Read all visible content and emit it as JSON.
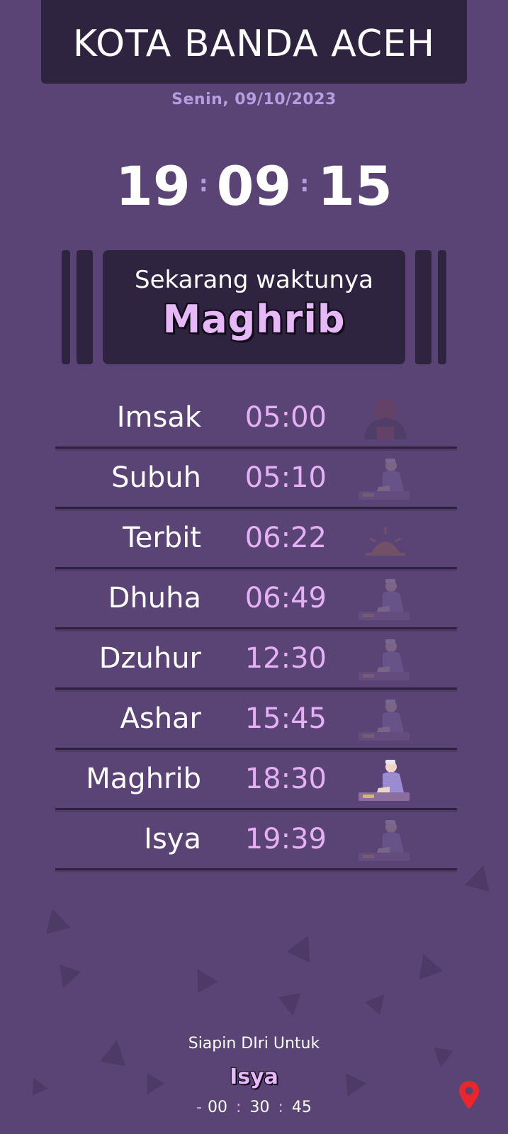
{
  "header": {
    "city": "KOTA BANDA ACEH",
    "date": "Senin, 09/10/2023"
  },
  "clock": {
    "hours": "19",
    "minutes": "09",
    "seconds": "15",
    "separator": ":"
  },
  "current": {
    "label": "Sekarang waktunya",
    "value": "Maghrib"
  },
  "prayers": [
    {
      "name": "Imsak",
      "time": "05:00",
      "icon": "person-hooded-icon",
      "active": false
    },
    {
      "name": "Subuh",
      "time": "05:10",
      "icon": "praying-person-icon",
      "active": false
    },
    {
      "name": "Terbit",
      "time": "06:22",
      "icon": "sunrise-icon",
      "active": false
    },
    {
      "name": "Dhuha",
      "time": "06:49",
      "icon": "praying-person-icon",
      "active": false
    },
    {
      "name": "Dzuhur",
      "time": "12:30",
      "icon": "praying-person-icon",
      "active": false
    },
    {
      "name": "Ashar",
      "time": "15:45",
      "icon": "praying-person-icon",
      "active": false
    },
    {
      "name": "Maghrib",
      "time": "18:30",
      "icon": "praying-person-icon",
      "active": true
    },
    {
      "name": "Isya",
      "time": "19:39",
      "icon": "praying-person-icon",
      "active": false
    }
  ],
  "next": {
    "label": "Siapin DIri Untuk",
    "name": "Isya",
    "countdown": {
      "sign": "-",
      "hours": "00",
      "minutes": "30",
      "seconds": "45",
      "separator": ":"
    }
  },
  "location_button": {
    "icon": "location-pin-icon",
    "color": "#e8262b"
  },
  "colors": {
    "background": "#5a4475",
    "panel": "#2f2440",
    "accent": "#e6b0f5",
    "muted": "#b79ce0"
  }
}
